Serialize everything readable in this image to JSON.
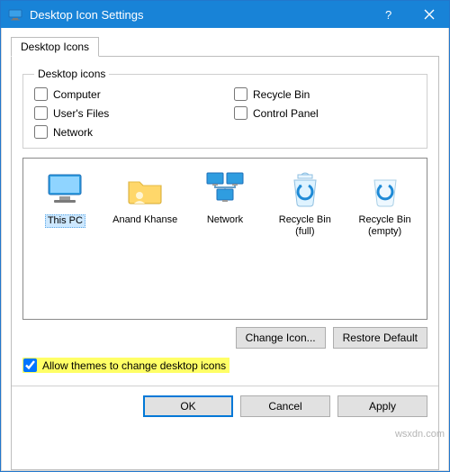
{
  "window": {
    "title": "Desktop Icon Settings"
  },
  "tabs": {
    "active": "Desktop Icons"
  },
  "group": {
    "legend": "Desktop icons",
    "items": [
      {
        "key": "computer",
        "label": "Computer",
        "checked": false
      },
      {
        "key": "recyclebin",
        "label": "Recycle Bin",
        "checked": false
      },
      {
        "key": "usersfiles",
        "label": "User's Files",
        "checked": false
      },
      {
        "key": "controlpanel",
        "label": "Control Panel",
        "checked": false
      },
      {
        "key": "network",
        "label": "Network",
        "checked": false
      }
    ]
  },
  "icons": [
    {
      "key": "thispc",
      "label": "This PC",
      "selected": true,
      "glyph": "thispc-icon"
    },
    {
      "key": "user",
      "label": "Anand Khanse",
      "selected": false,
      "glyph": "userfolder-icon"
    },
    {
      "key": "network",
      "label": "Network",
      "selected": false,
      "glyph": "network-icon"
    },
    {
      "key": "rb_full",
      "label": "Recycle Bin (full)",
      "selected": false,
      "glyph": "recycle-full-icon"
    },
    {
      "key": "rb_empty",
      "label": "Recycle Bin (empty)",
      "selected": false,
      "glyph": "recycle-empty-icon"
    }
  ],
  "buttons": {
    "change": "Change Icon...",
    "restore": "Restore Default",
    "ok": "OK",
    "cancel": "Cancel",
    "apply": "Apply"
  },
  "allow": {
    "label": "Allow themes to change desktop icons",
    "checked": true
  },
  "watermark": "wsxdn.com"
}
